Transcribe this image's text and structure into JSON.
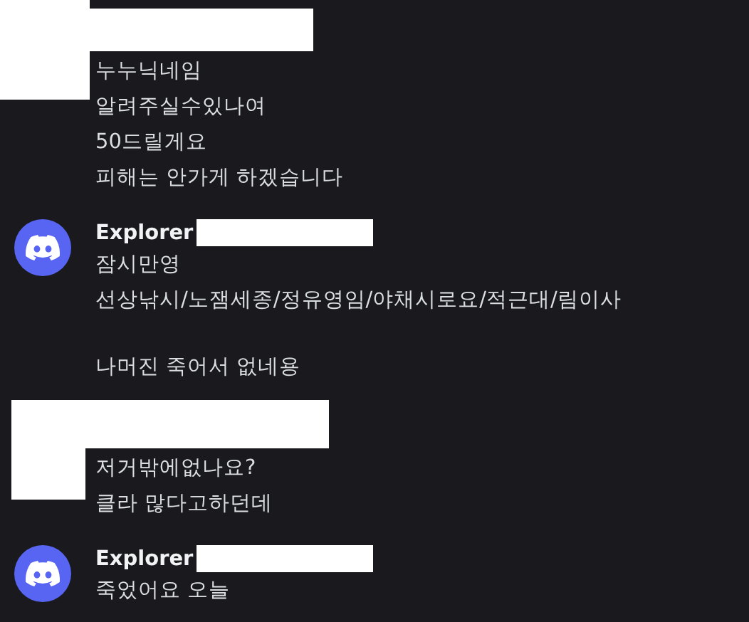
{
  "groups": [
    {
      "avatar": {
        "kind": "redacted"
      },
      "header": {
        "kind": "redacted"
      },
      "messages": [
        {
          "paragraphs": [
            "누누닉네임"
          ]
        },
        {
          "paragraphs": [
            "알려주실수있나여"
          ]
        },
        {
          "paragraphs": [
            "50드릴게요"
          ]
        },
        {
          "paragraphs": [
            "피해는 안가게 하겠습니다"
          ]
        }
      ]
    },
    {
      "avatar": {
        "kind": "discord"
      },
      "header": {
        "kind": "user",
        "name": "Explorer",
        "tag_redacted": true
      },
      "messages": [
        {
          "paragraphs": [
            "잠시만영"
          ]
        },
        {
          "paragraphs": [
            "선상낚시/노잼세종/정유영임/야채시로요/적근대/림이사",
            "나머진 죽어서 없네용"
          ]
        }
      ]
    },
    {
      "avatar": {
        "kind": "redacted"
      },
      "header": {
        "kind": "redacted"
      },
      "messages": [
        {
          "paragraphs": [
            "저거밖에없나요?"
          ]
        },
        {
          "paragraphs": [
            "클라 많다고하던데"
          ]
        }
      ]
    },
    {
      "avatar": {
        "kind": "discord"
      },
      "header": {
        "kind": "user",
        "name": "Explorer",
        "tag_redacted": true
      },
      "messages": [
        {
          "paragraphs": [
            "죽었어요 오늘"
          ]
        }
      ]
    }
  ]
}
